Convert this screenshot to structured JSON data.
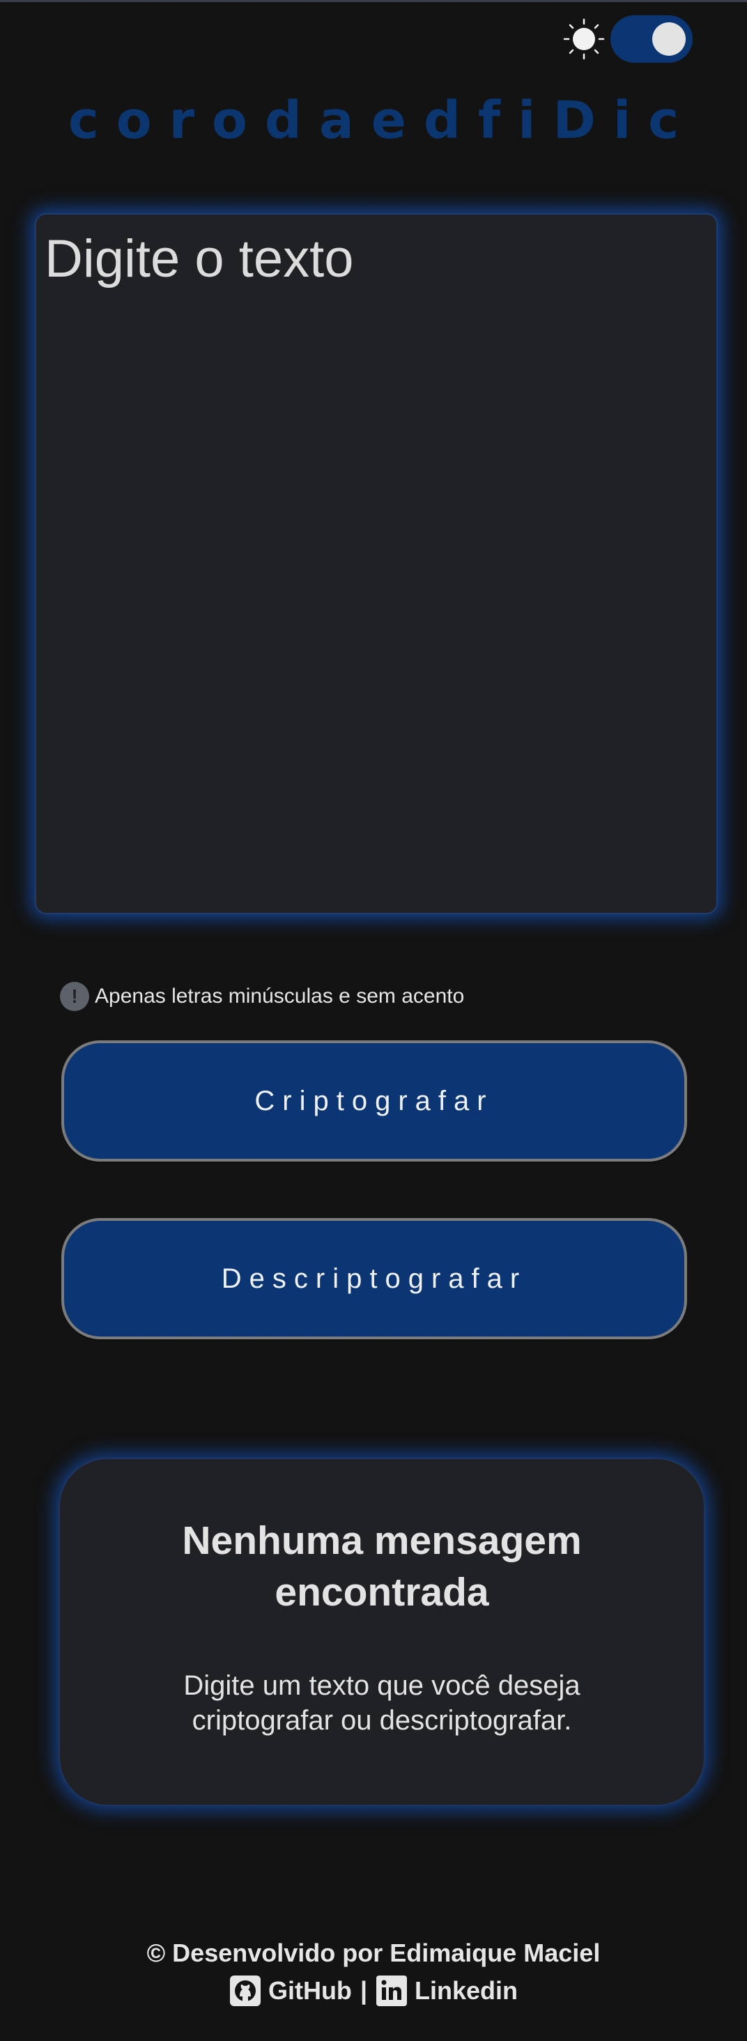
{
  "theme": {
    "icon": "sun-icon",
    "toggle_state": "on",
    "colors": {
      "accent": "#0c3673",
      "background": "#131313",
      "panel": "#202124",
      "glow": "#1454be"
    }
  },
  "logo": {
    "text": "corodaedfiDic"
  },
  "input": {
    "placeholder": "Digite o texto",
    "value": ""
  },
  "hint": {
    "icon": "exclamation-icon",
    "text": "Apenas letras minúsculas e sem acento"
  },
  "buttons": {
    "encrypt_label": "Criptografar",
    "decrypt_label": "Descriptografar"
  },
  "output": {
    "title": "Nenhuma mensagem encontrada",
    "description": "Digite um texto que você deseja criptografar ou descriptografar."
  },
  "footer": {
    "credit": "© Desenvolvido por Edimaique Maciel",
    "github_label": "GitHub",
    "separator": "|",
    "linkedin_label": "Linkedin",
    "github_icon": "github-icon",
    "linkedin_icon": "linkedin-icon"
  }
}
